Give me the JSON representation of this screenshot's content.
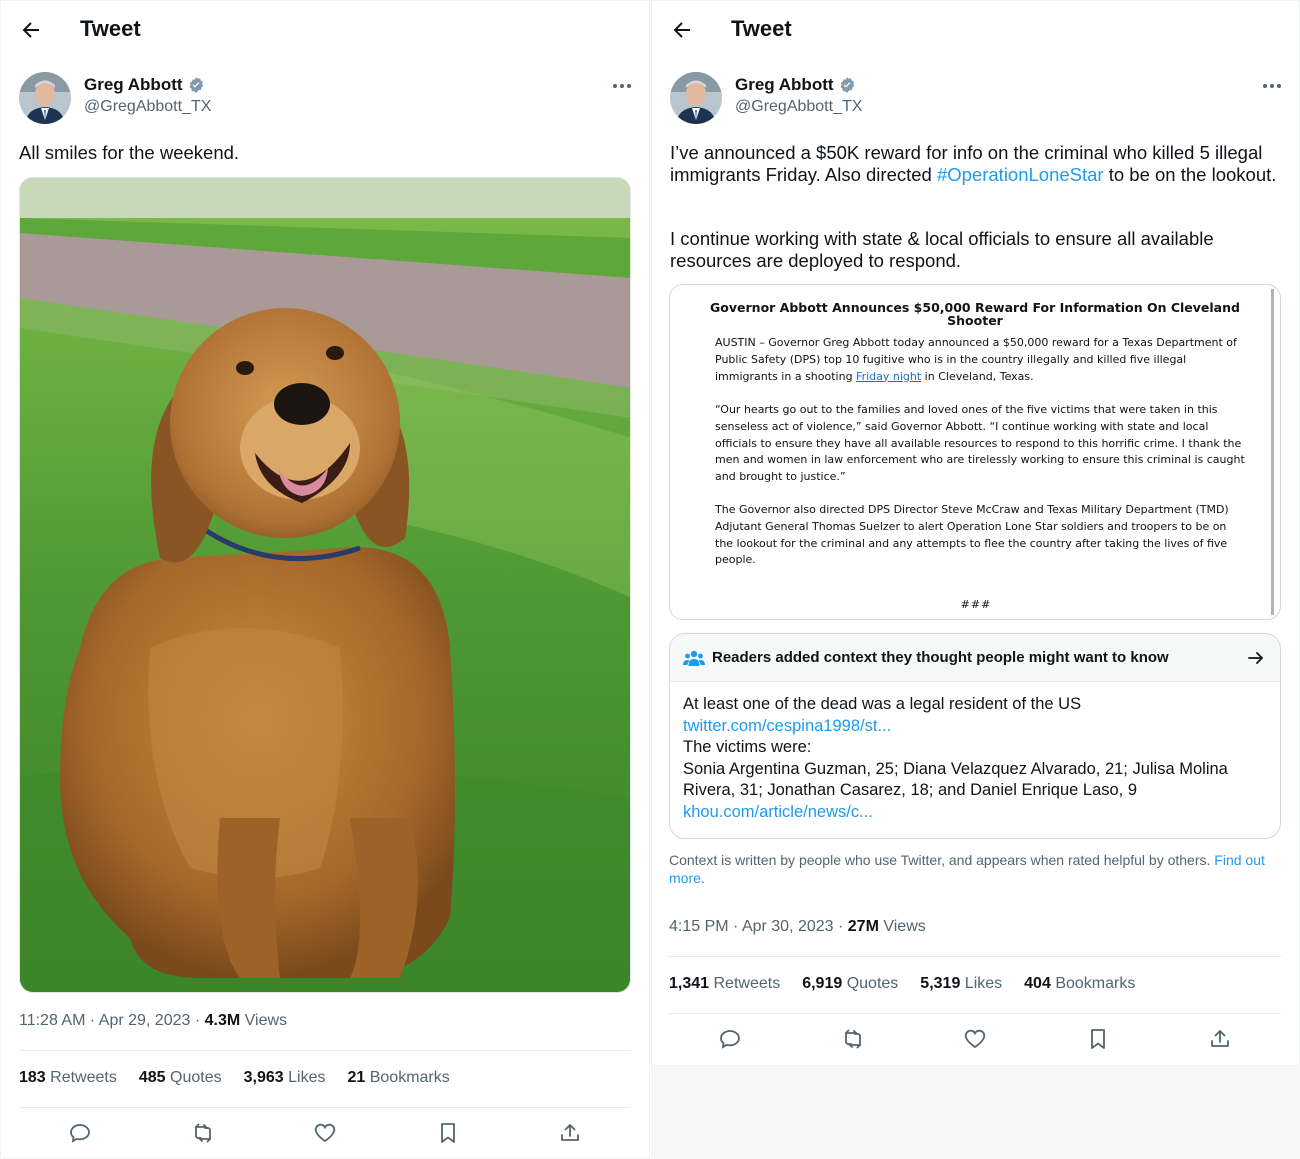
{
  "left": {
    "header_title": "Tweet",
    "author_name": "Greg Abbott",
    "author_handle": "@GregAbbott_TX",
    "text": "All smiles for the weekend.",
    "photo_icon": "golden-retriever-photo",
    "time": "11:28 AM",
    "date": "Apr 29, 2023",
    "views_count": "4.3M",
    "views_label": "Views",
    "stats": [
      {
        "value": "183",
        "label": "Retweets"
      },
      {
        "value": "485",
        "label": "Quotes"
      },
      {
        "value": "3,963",
        "label": "Likes"
      },
      {
        "value": "21",
        "label": "Bookmarks"
      }
    ]
  },
  "right": {
    "header_title": "Tweet",
    "author_name": "Greg Abbott",
    "author_handle": "@GregAbbott_TX",
    "text_part1": "I’ve announced a $50K reward for info on the criminal who killed 5 illegal immigrants Friday. Also directed ",
    "hashtag": "#OperationLoneStar",
    "text_part2": " to be on the lookout.",
    "text_para2": "I continue working with state & local officials to ensure all available resources are deployed to respond.",
    "press": {
      "title": "Governor Abbott Announces $50,000 Reward For Information On Cleveland Shooter",
      "p1_a": "AUSTIN – Governor Greg Abbott today announced a $50,000 reward for a Texas Department of Public Safety (DPS) top 10 fugitive who is in the country illegally and killed five illegal immigrants in a shooting ",
      "p1_link": "Friday night",
      "p1_b": " in Cleveland, Texas.",
      "p2": "“Our hearts go out to the families and loved ones of the five victims that were taken in this senseless act of violence,” said Governor Abbott. “I continue working with state and local officials to ensure they have all available resources to respond to this horrific crime. I thank the men and women in law enforcement who are tirelessly working to ensure this criminal is caught and brought to justice.”",
      "p3": "The Governor also directed DPS Director Steve McCraw and Texas Military Department (TMD) Adjutant General Thomas Suelzer to alert Operation Lone Star soldiers and troopers to be on the lookout for the criminal and any attempts to flee the country after taking the lives of five people.",
      "end": "###"
    },
    "note": {
      "header": "Readers added context they thought people might want to know",
      "line1": "At least one of the dead was a legal resident of the US",
      "link1": "twitter.com/cespina1998/st...",
      "line2": "The victims were:",
      "line3": "Sonia Argentina Guzman, 25; Diana Velazquez Alvarado, 21; Julisa Molina Rivera, 31; Jonathan Casarez, 18; and Daniel Enrique Laso, 9",
      "link2": "khou.com/article/news/c..."
    },
    "note_footer": "Context is written by people who use Twitter, and appears when rated helpful by others. ",
    "note_footer_link": "Find out more",
    "note_footer_end": ".",
    "time": "4:15 PM",
    "date": "Apr 30, 2023",
    "views_count": "27M",
    "views_label": "Views",
    "stats": [
      {
        "value": "1,341",
        "label": "Retweets"
      },
      {
        "value": "6,919",
        "label": "Quotes"
      },
      {
        "value": "5,319",
        "label": "Likes"
      },
      {
        "value": "404",
        "label": "Bookmarks"
      }
    ]
  },
  "colors": {
    "accent": "#1d9bf0",
    "text": "#0f1419",
    "secondary": "#536471",
    "border": "#cfd9de"
  },
  "icons": [
    "back-arrow-icon",
    "verified-icon",
    "more-icon",
    "reply-icon",
    "retweet-icon",
    "like-icon",
    "bookmark-icon",
    "share-icon",
    "people-icon",
    "arrow-right-icon"
  ]
}
